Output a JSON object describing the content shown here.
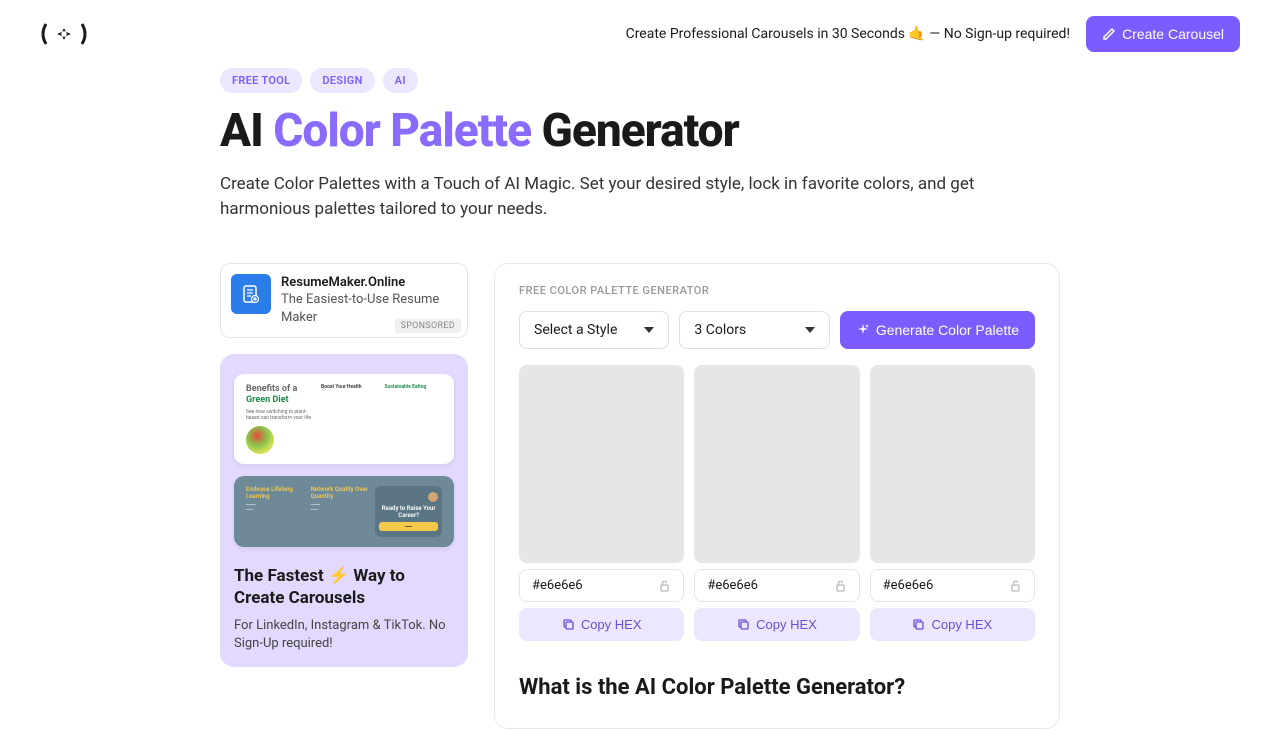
{
  "header": {
    "tagline": "Create Professional Carousels in 30 Seconds 🤙 — No Sign-up required!",
    "cta": "Create Carousel"
  },
  "tags": [
    "FREE TOOL",
    "DESIGN",
    "AI"
  ],
  "title_pre": "AI ",
  "title_accent": "Color Palette",
  "title_post": " Generator",
  "subtitle": "Create Color Palettes with a Touch of AI Magic. Set your desired style, lock in favorite colors, and get harmonious palettes tailored to your needs.",
  "ad": {
    "title": "ResumeMaker.Online",
    "sub": "The Easiest-to-Use Resume Maker",
    "badge": "SPONSORED"
  },
  "promo": {
    "slide1_title_pre": "Benefits of a",
    "slide1_title_accent": "Green Diet",
    "slide1_col1": "See how switching to plant-based can transform your life",
    "slide1_col2_h": "Boost Your Health",
    "slide1_col3_h": "Sustainable Eating",
    "slide2_c1_h": "Embrace Lifelong Learning",
    "slide2_c2_h": "Network Quality Over Quantity",
    "slide2_c3_t": "Ready to Raise Your Career?",
    "heading": "The Fastest ⚡ Way to Create Carousels",
    "desc": "For LinkedIn, Instagram & TikTok. No Sign-Up required!"
  },
  "panel": {
    "label": "FREE COLOR PALETTE GENERATOR",
    "style_label": "Select a Style",
    "count_label": "3 Colors",
    "generate": "Generate Color Palette",
    "swatches": [
      {
        "hex": "#e6e6e6",
        "copy": "Copy  HEX"
      },
      {
        "hex": "#e6e6e6",
        "copy": "Copy  HEX"
      },
      {
        "hex": "#e6e6e6",
        "copy": "Copy  HEX"
      }
    ],
    "section_title": "What is the AI Color Palette Generator?"
  }
}
